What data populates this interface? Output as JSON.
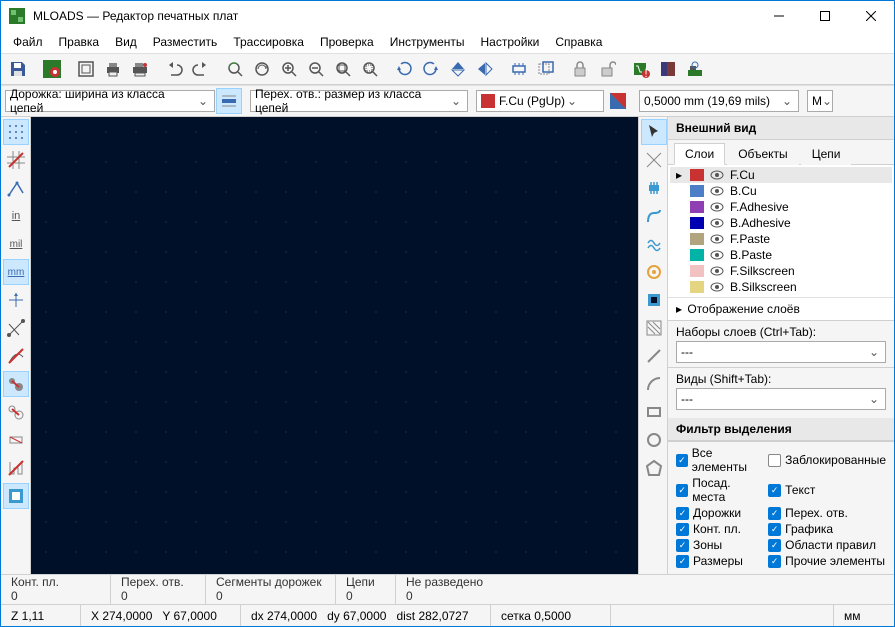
{
  "title": "MLOADS — Редактор печатных плат",
  "menu": [
    "Файл",
    "Правка",
    "Вид",
    "Разместить",
    "Трассировка",
    "Проверка",
    "Инструменты",
    "Настройки",
    "Справка"
  ],
  "toolbar2": {
    "track_width": "Дорожка: ширина из класса цепей",
    "via_size": "Перех. отв.: размер из класса цепей",
    "layer": "F.Cu (PgUp)",
    "grid": "0,5000 mm (19,69 mils)",
    "zoom_mode": "М"
  },
  "appearance": {
    "header": "Внешний вид",
    "tabs": {
      "layers": "Слои",
      "objects": "Объекты",
      "nets": "Цепи"
    },
    "layers": [
      {
        "name": "F.Cu",
        "color": "#c83232",
        "selected": true
      },
      {
        "name": "B.Cu",
        "color": "#4d7fc8"
      },
      {
        "name": "F.Adhesive",
        "color": "#8f3fb3"
      },
      {
        "name": "B.Adhesive",
        "color": "#0000b3"
      },
      {
        "name": "F.Paste",
        "color": "#b2a47e"
      },
      {
        "name": "B.Paste",
        "color": "#00b3a6"
      },
      {
        "name": "F.Silkscreen",
        "color": "#f2c2c2"
      },
      {
        "name": "B.Silkscreen",
        "color": "#e6d580"
      }
    ],
    "disp_layers": "Отображение слоёв",
    "presets_label": "Наборы слоев (Ctrl+Tab):",
    "presets_value": "---",
    "views_label": "Виды (Shift+Tab):",
    "views_value": "---"
  },
  "filter": {
    "header": "Фильтр выделения",
    "items": [
      {
        "label": "Все элементы",
        "checked": true
      },
      {
        "label": "Заблокированные",
        "checked": false
      },
      {
        "label": "Посад. места",
        "checked": true
      },
      {
        "label": "Текст",
        "checked": true
      },
      {
        "label": "Дорожки",
        "checked": true
      },
      {
        "label": "Перех. отв.",
        "checked": true
      },
      {
        "label": "Конт. пл.",
        "checked": true
      },
      {
        "label": "Графика",
        "checked": true
      },
      {
        "label": "Зоны",
        "checked": true
      },
      {
        "label": "Области правил",
        "checked": true
      },
      {
        "label": "Размеры",
        "checked": true
      },
      {
        "label": "Прочие элементы",
        "checked": true
      }
    ]
  },
  "status1": {
    "pads": {
      "label": "Конт. пл.",
      "value": "0"
    },
    "vias": {
      "label": "Перех. отв.",
      "value": "0"
    },
    "segments": {
      "label": "Сегменты дорожек",
      "value": "0"
    },
    "nets": {
      "label": "Цепи",
      "value": "0"
    },
    "unrouted": {
      "label": "Не разведено",
      "value": "0"
    }
  },
  "status2": {
    "zoom": "Z 1,11",
    "x": "X 274,0000",
    "y": "Y 67,0000",
    "dx": "dx 274,0000",
    "dy": "dy 67,0000",
    "dist": "dist 282,0727",
    "grid": "сетка 0,5000",
    "units": "мм"
  }
}
